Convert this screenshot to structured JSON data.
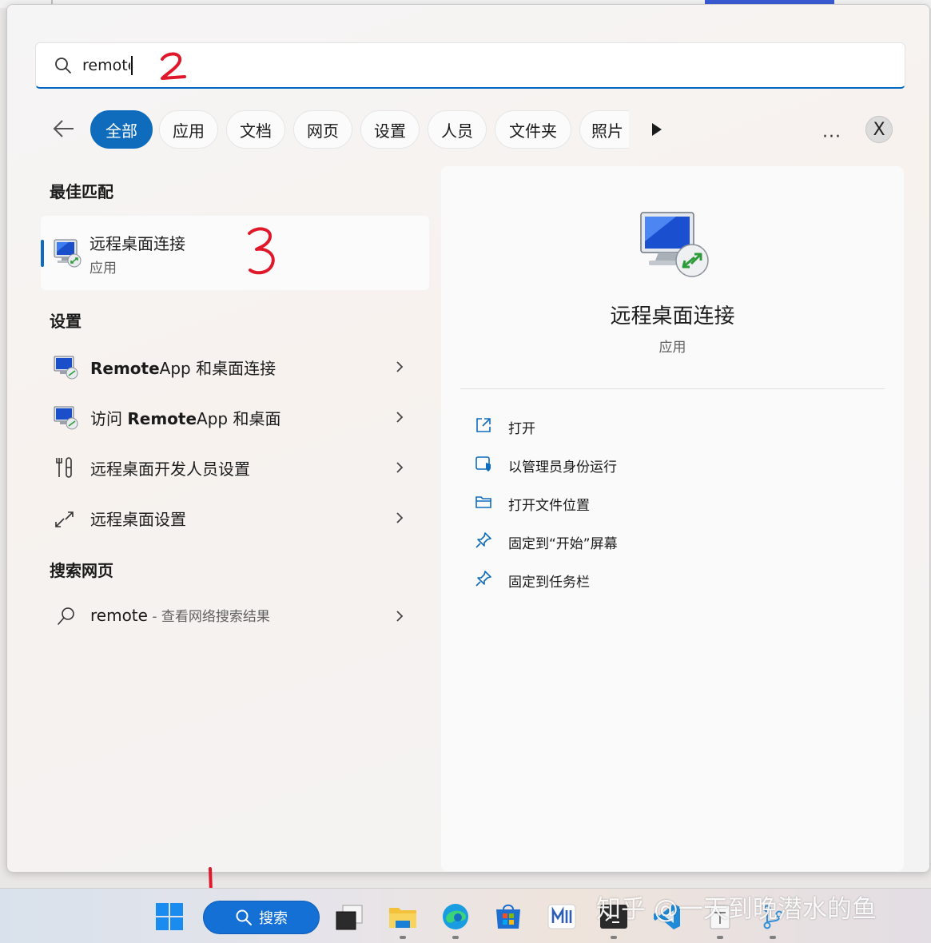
{
  "search": {
    "query": "remote",
    "annotation_step2": "2"
  },
  "filters": {
    "items": [
      "全部",
      "应用",
      "文档",
      "网页",
      "设置",
      "人员",
      "文件夹",
      "照片"
    ],
    "close_label": "X",
    "more_label": "···"
  },
  "best_match": {
    "section_title": "最佳匹配",
    "name": "远程桌面连接",
    "type": "应用",
    "annotation_step3": "3"
  },
  "settings": {
    "section_title": "设置",
    "items": [
      {
        "pre": "",
        "bold": "Remote",
        "post": "App 和桌面连接"
      },
      {
        "pre": "访问 ",
        "bold": "Remote",
        "post": "App 和桌面"
      },
      {
        "pre": "远程桌面开发人员设置",
        "bold": "",
        "post": ""
      },
      {
        "pre": "远程桌面设置",
        "bold": "",
        "post": ""
      }
    ]
  },
  "web": {
    "section_title": "搜索网页",
    "query": "remote",
    "suffix": " - 查看网络搜索结果"
  },
  "detail": {
    "title": "远程桌面连接",
    "type": "应用",
    "actions": [
      "打开",
      "以管理员身份运行",
      "打开文件位置",
      "固定到“开始”屏幕",
      "固定到任务栏"
    ]
  },
  "taskbar": {
    "search_label": "搜索",
    "annotation_step1": "1"
  },
  "watermark": "知乎 @一天到晚潜水的鱼",
  "colors": {
    "accent": "#0f6cbd",
    "annotation": "#e0192a"
  }
}
